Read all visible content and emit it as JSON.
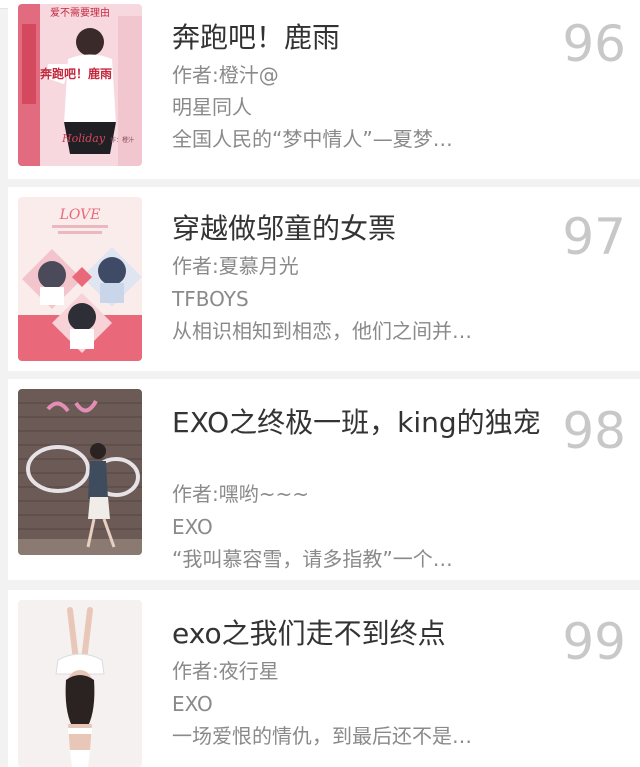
{
  "books": [
    {
      "title": "奔跑吧！鹿雨",
      "author": "作者:橙汁@",
      "tag": "明星同人",
      "desc": "全国人民的“梦中情人”—夏梦…",
      "rank": "96",
      "cover": {
        "top_text": "爱不需要理由",
        "mid_text": "奔跑吧！鹿雨",
        "bottom_text": "Holiday",
        "credit": "作：橙汁",
        "colors": [
          "#f7d8de",
          "#e36b80",
          "#ffffff"
        ]
      }
    },
    {
      "title": "穿越做邬童的女票",
      "author": "作者:夏慕月光",
      "tag": "TFBOYS",
      "desc": "从相识相知到相恋，他们之间并…",
      "rank": "97",
      "cover": {
        "top_text": "LOVE",
        "colors": [
          "#fbecec",
          "#e9697a",
          "#4a4a5a"
        ]
      }
    },
    {
      "title": "EXO之终极一班，king的独宠",
      "author": "作者:嘿哟~~~",
      "tag": "EXO",
      "desc": "“我叫慕容雪，请多指教”一个…",
      "rank": "98",
      "cover": {
        "colors": [
          "#6b5a55",
          "#c9c2c6",
          "#e38fb5"
        ]
      }
    },
    {
      "title": "exo之我们走不到终点",
      "author": "作者:夜行星",
      "tag": "EXO",
      "desc": "一场爱恨的情仇，到最后还不是…",
      "rank": "99",
      "cover": {
        "colors": [
          "#f4f1f0",
          "#2b2321",
          "#e8c7b8"
        ]
      }
    }
  ]
}
